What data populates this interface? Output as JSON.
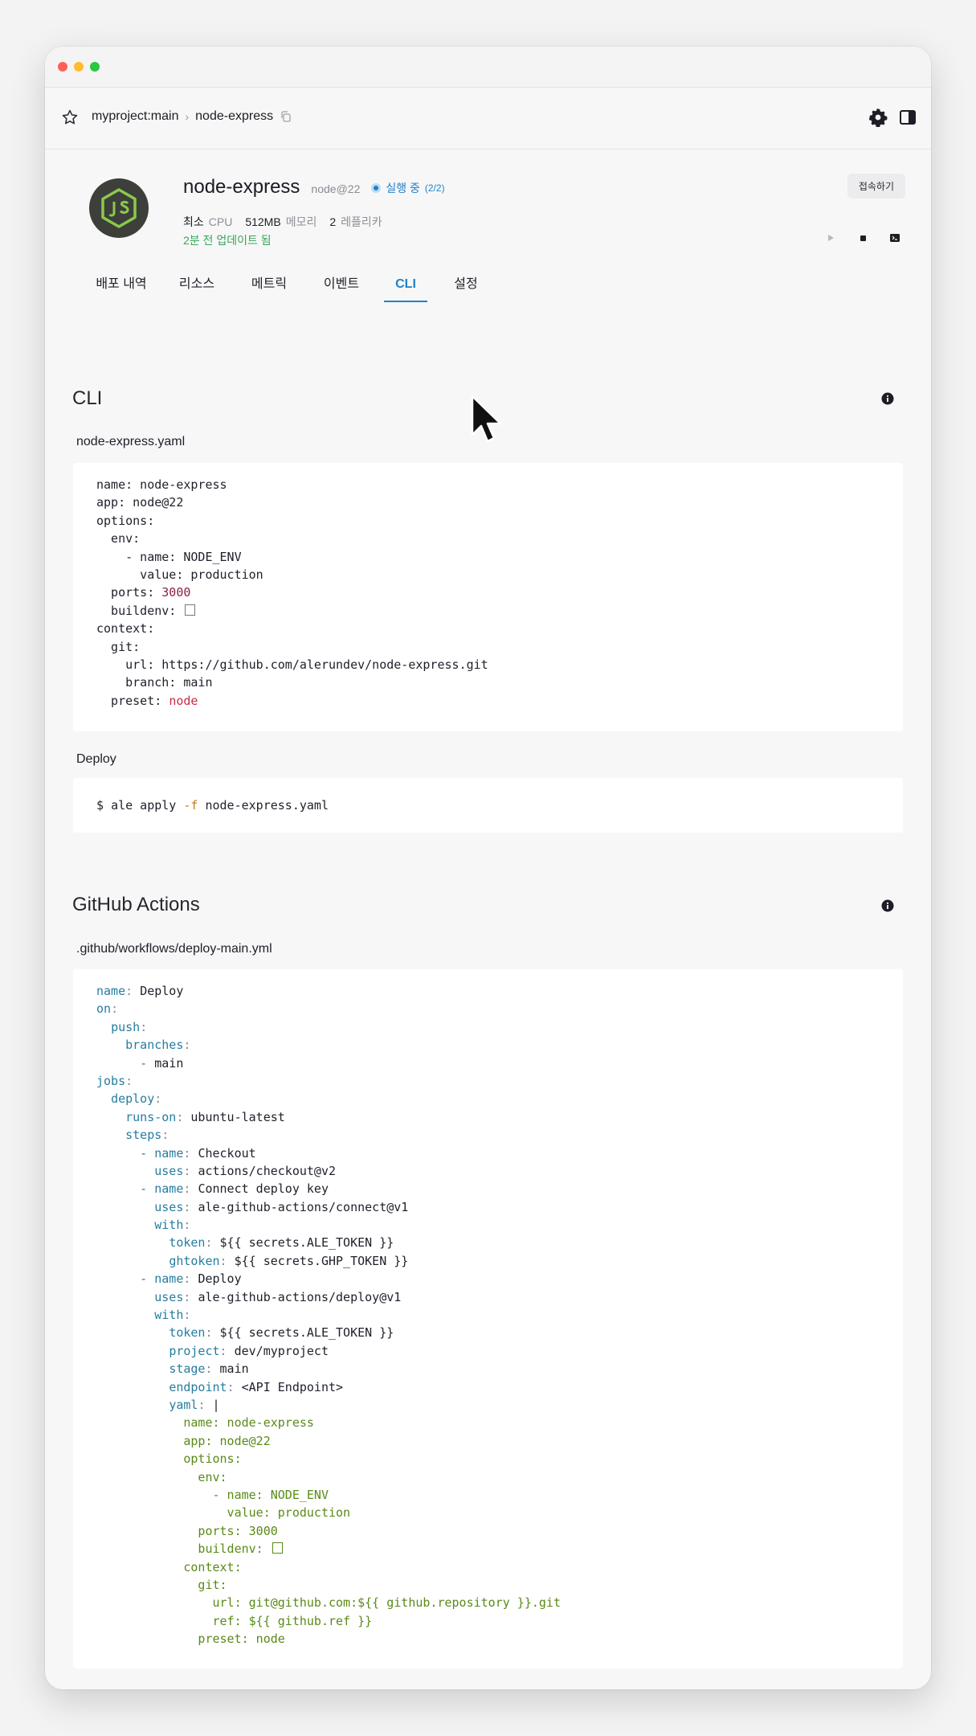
{
  "breadcrumb": {
    "project": "myproject:main",
    "separator": "›",
    "service": "node-express"
  },
  "app": {
    "name": "node-express",
    "runtime": "node@22",
    "status": "실행 중",
    "status_count": "(2/2)",
    "metrics": [
      {
        "value": "최소",
        "label": "CPU"
      },
      {
        "value": "512MB",
        "label": "메모리"
      },
      {
        "value": "2",
        "label": "레플리카"
      }
    ],
    "updated": "2분 전 업데이트 됨",
    "connect_label": "접속하기"
  },
  "tabs": [
    {
      "label": "배포 내역",
      "active": false
    },
    {
      "label": "리소스",
      "active": false
    },
    {
      "label": "메트릭",
      "active": false
    },
    {
      "label": "이벤트",
      "active": false
    },
    {
      "label": "CLI",
      "active": true
    },
    {
      "label": "설정",
      "active": false
    }
  ],
  "cli_section": {
    "title": "CLI",
    "file_label": "node-express.yaml",
    "deploy_label": "Deploy",
    "deploy_prompt": "$",
    "deploy_cmd": "ale apply",
    "deploy_flag": "-f",
    "deploy_arg": "node-express.yaml"
  },
  "cli_yaml": [
    "name: node-express",
    "app: node@22",
    "options:",
    "  env:",
    "    - name: NODE_ENV",
    "      value: production",
    "  ports: ",
    "  buildenv: ",
    "context:",
    "  git:",
    "    url: https://github.com/alerundev/node-express.git",
    "    branch: main",
    "  preset: "
  ],
  "cli_values": {
    "ports": "3000",
    "preset": "node"
  },
  "github_section": {
    "title": "GitHub Actions",
    "file_label": ".github/workflows/deploy-main.yml"
  },
  "workflow_lines": [
    [
      "",
      "name",
      "Deploy"
    ],
    [
      "",
      "on",
      ""
    ],
    [
      "  ",
      "push",
      ""
    ],
    [
      "    ",
      "branches",
      ""
    ],
    [
      "      - ",
      "",
      "main"
    ],
    [
      "",
      "jobs",
      ""
    ],
    [
      "  ",
      "deploy",
      ""
    ],
    [
      "    ",
      "runs-on",
      "ubuntu-latest"
    ],
    [
      "    ",
      "steps",
      ""
    ],
    [
      "      - ",
      "name",
      "Checkout"
    ],
    [
      "        ",
      "uses",
      "actions/checkout@v2"
    ],
    [
      "      - ",
      "name",
      "Connect deploy key"
    ],
    [
      "        ",
      "uses",
      "ale-github-actions/connect@v1"
    ],
    [
      "        ",
      "with",
      ""
    ],
    [
      "          ",
      "token",
      "${{ secrets.ALE_TOKEN }}"
    ],
    [
      "          ",
      "ghtoken",
      "${{ secrets.GHP_TOKEN }}"
    ],
    [
      "      - ",
      "name",
      "Deploy"
    ],
    [
      "        ",
      "uses",
      "ale-github-actions/deploy@v1"
    ],
    [
      "        ",
      "with",
      ""
    ],
    [
      "          ",
      "token",
      "${{ secrets.ALE_TOKEN }}"
    ],
    [
      "          ",
      "project",
      "dev/myproject"
    ],
    [
      "          ",
      "stage",
      "main"
    ],
    [
      "          ",
      "endpoint",
      "<API Endpoint>"
    ],
    [
      "          ",
      "yaml",
      "|"
    ]
  ],
  "workflow_yaml_body": [
    "            name: node-express",
    "            app: node@22",
    "            options:",
    "              env:",
    "                - name: NODE_ENV",
    "                  value: production",
    "              ports: 3000",
    "              buildenv: ",
    "            context:",
    "              git:",
    "                url: git@github.com:${{ github.repository }}.git",
    "                ref: ${{ github.ref }}",
    "              preset: node"
  ],
  "colors": {
    "accent": "#1f82c9",
    "updated": "#3aa55a",
    "node_logo": "#8cc84b"
  }
}
